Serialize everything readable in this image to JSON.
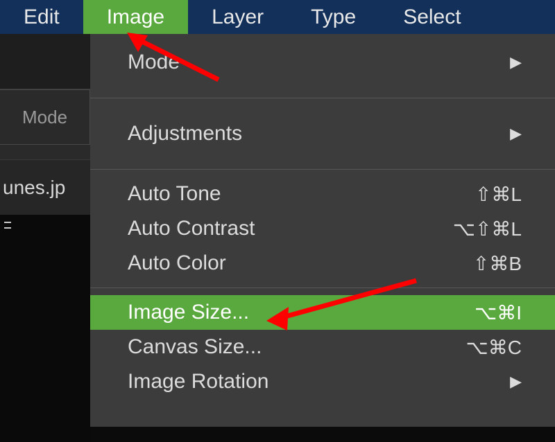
{
  "menubar": {
    "items": [
      {
        "label": "Edit"
      },
      {
        "label": "Image"
      },
      {
        "label": "Layer"
      },
      {
        "label": "Type"
      },
      {
        "label": "Select"
      }
    ]
  },
  "sidebar": {
    "mode_label": "Mode",
    "tab_label": "unes.jp"
  },
  "dropdown": {
    "items": [
      {
        "label": "Mode",
        "shortcut": "",
        "submenu": true
      },
      {
        "label": "Adjustments",
        "shortcut": "",
        "submenu": true
      },
      {
        "label": "Auto Tone",
        "shortcut": "⇧⌘L",
        "submenu": false
      },
      {
        "label": "Auto Contrast",
        "shortcut": "⌥⇧⌘L",
        "submenu": false
      },
      {
        "label": "Auto Color",
        "shortcut": "⇧⌘B",
        "submenu": false
      },
      {
        "label": "Image Size...",
        "shortcut": "⌥⌘I",
        "submenu": false
      },
      {
        "label": "Canvas Size...",
        "shortcut": "⌥⌘C",
        "submenu": false
      },
      {
        "label": "Image Rotation",
        "shortcut": "",
        "submenu": true
      }
    ]
  }
}
